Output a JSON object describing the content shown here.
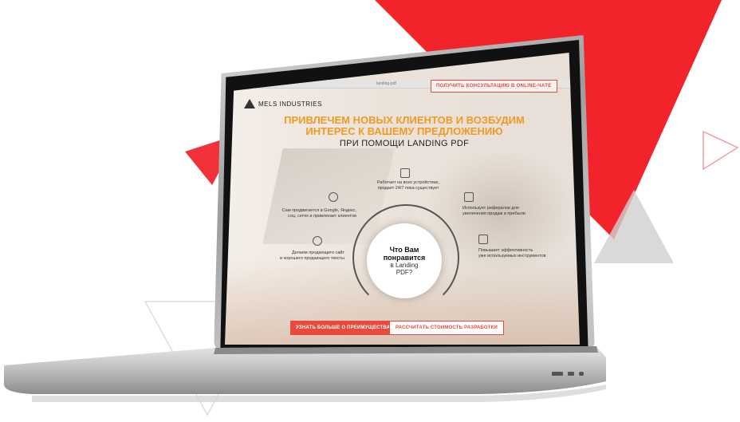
{
  "browser": {
    "url": "landing-pdf"
  },
  "logo": {
    "text": "MELS INDUSTRIES"
  },
  "header": {
    "consult_label": "ПОЛУЧИТЬ КОНСУЛЬТАЦИЮ В ONLINE-ЧАТЕ"
  },
  "hero": {
    "headline_1": "ПРИВЛЕЧЕМ НОВЫХ КЛИЕНТОВ И ВОЗБУДИМ",
    "headline_2": "ИНТЕРЕС К ВАШЕМУ ПРЕДЛОЖЕНИЮ",
    "subline": "ПРИ ПОМОЩИ LANDING PDF"
  },
  "features": [
    {
      "text_1": "Работает на всех устройствах,",
      "text_2": "продает 24/7 пока существует",
      "icon": "monitor-icon"
    },
    {
      "text_1": "Сам продвигается в Google, Яндекс,",
      "text_2": "соц. сетях и привлекает клиентов",
      "icon": "megaphone-icon"
    },
    {
      "text_1": "Использует рефералов для",
      "text_2": "увеличения продаж и прибыли",
      "icon": "share-icon"
    },
    {
      "text_1": "Делаем продающего сайт",
      "text_2": "и хорошего продающего тексты",
      "icon": "piggy-bank-icon"
    },
    {
      "text_1": "Повышает эффективность",
      "text_2": "уже используемых инструментов",
      "icon": "bar-chart-icon"
    }
  ],
  "center": {
    "line_1": "Что Вам",
    "line_2": "понравится",
    "line_3": "в Landing",
    "line_4": "PDF?"
  },
  "cta": {
    "primary_label": "УЗНАТЬ БОЛЬШЕ О ПРЕИМУЩЕСТВАХ",
    "secondary_label": "РАССЧИТАТЬ СТОИМОСТЬ РАЗРАБОТКИ"
  },
  "colors": {
    "accent": "#e84a3c",
    "headline": "#f29a1f",
    "triangle_red": "#f2232b",
    "triangle_gray": "#c8c8c8"
  }
}
